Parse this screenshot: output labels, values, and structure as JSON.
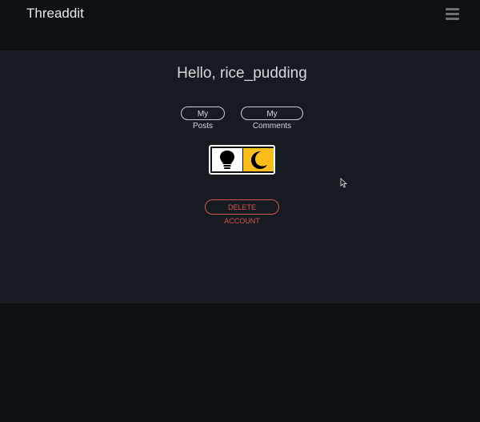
{
  "navbar": {
    "brand": "Threaddit",
    "menu_icon": "hamburger-menu-icon"
  },
  "profile": {
    "greeting": "Hello, rice_pudding",
    "buttons": {
      "posts": "My Posts",
      "comments": "My Comments"
    },
    "theme_toggle": {
      "light_icon": "lightbulb-icon",
      "dark_icon": "moon-icon",
      "active_color": "#fbbd1a",
      "selected": "dark"
    },
    "delete_label": "DELETE ACCOUNT",
    "delete_color": "#d9534f"
  }
}
